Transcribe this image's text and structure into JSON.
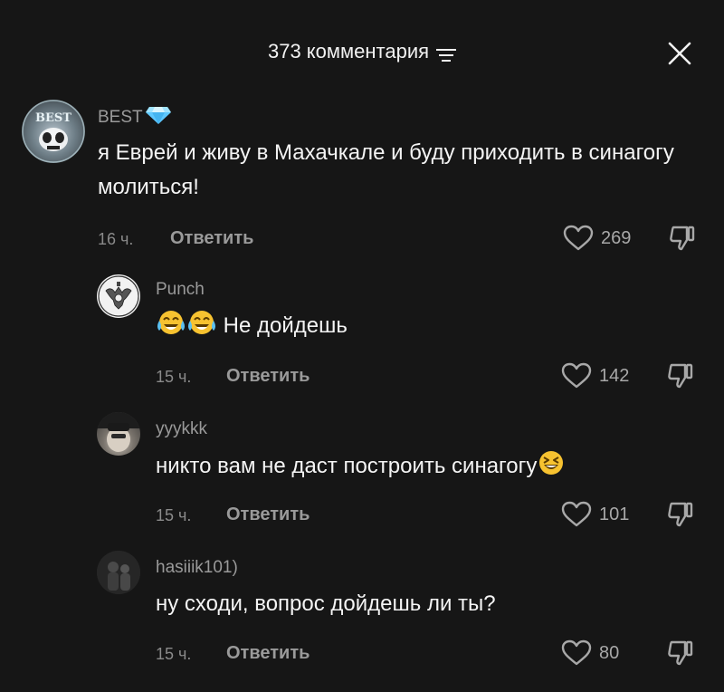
{
  "header": {
    "count_title": "373 комментария",
    "filter_icon": "filter-lines-icon",
    "close_icon": "close-icon"
  },
  "comments": [
    {
      "username": "BEST",
      "badge_icon": "diamond-icon",
      "avatar_text": "BEST",
      "text": "я Еврей и живу в Махачкале и буду приходить в синагогу молиться!",
      "time": "16 ч.",
      "reply_label": "Ответить",
      "likes": "269"
    },
    {
      "username": "Punch",
      "text": "Не дойдешь",
      "emojis": [
        "crying-laughing-emoji",
        "crying-laughing-emoji"
      ],
      "time": "15 ч.",
      "reply_label": "Ответить",
      "likes": "142"
    },
    {
      "username": "yyykkk",
      "text": "никто вам не даст построить синагогу",
      "emojis": [
        "squinting-laughing-emoji"
      ],
      "time": "15 ч.",
      "reply_label": "Ответить",
      "likes": "101"
    },
    {
      "username": "hasiiik101)",
      "text": "ну сходи, вопрос дойдешь ли ты?",
      "time": "15 ч.",
      "reply_label": "Ответить",
      "likes": "80"
    }
  ],
  "colors": {
    "background": "#161616",
    "text_primary": "#f4f4f4",
    "text_secondary": "#9a9a9a",
    "badge": "#7fd3ff",
    "emoji_yellow": "#f7c230"
  }
}
